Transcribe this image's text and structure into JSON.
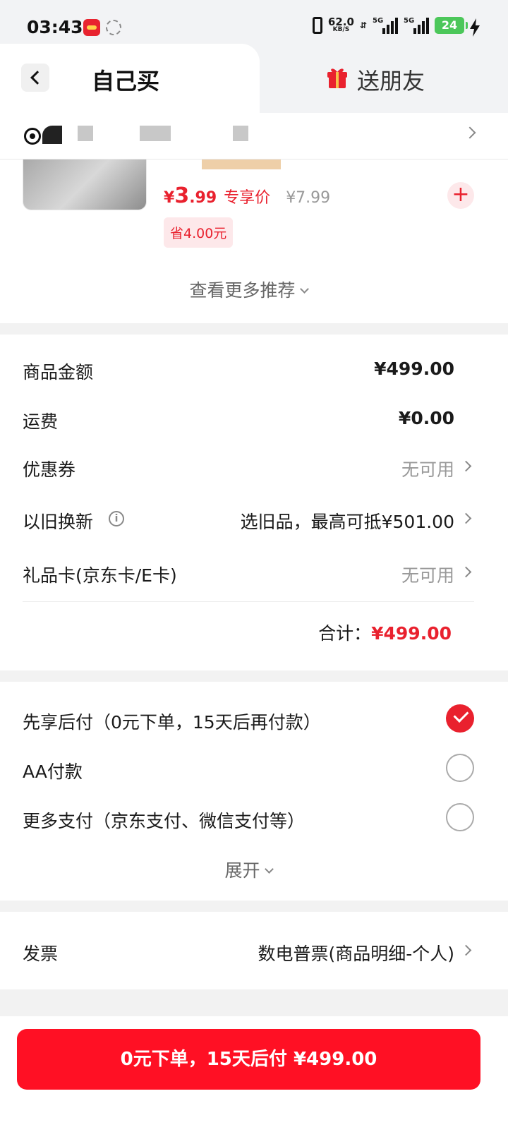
{
  "status_bar": {
    "time": "03:43",
    "net_speed": "62.0",
    "net_speed_unit": "KB/S",
    "signal_label_1": "5G",
    "signal_label_2": "5G",
    "battery": "24"
  },
  "tabs": {
    "self_buy": "自己买",
    "gift_friend": "送朋友"
  },
  "recommendation": {
    "price_symbol": "¥",
    "price_main": "3",
    "price_cents": ".99",
    "price_tag": "专享价",
    "original_price": "¥7.99",
    "savings": "省4.00元",
    "see_more": "查看更多推荐"
  },
  "amounts": {
    "goods_label": "商品金额",
    "goods_value": "¥499.00",
    "shipping_label": "运费",
    "shipping_value": "¥0.00",
    "coupon_label": "优惠券",
    "coupon_value": "无可用",
    "tradein_label": "以旧换新",
    "tradein_value": "选旧品，最高可抵¥501.00",
    "giftcard_label": "礼品卡(京东卡/E卡)",
    "giftcard_value": "无可用",
    "total_label": "合计：",
    "total_value": "¥499.00"
  },
  "payment": {
    "options": [
      {
        "label": "先享后付（0元下单，15天后再付款）",
        "selected": true
      },
      {
        "label": "AA付款",
        "selected": false
      },
      {
        "label": "更多支付（京东支付、微信支付等）",
        "selected": false
      }
    ],
    "expand": "展开"
  },
  "invoice": {
    "label": "发票",
    "value": "数电普票(商品明细-个人)"
  },
  "submit": {
    "label": "0元下单，15天后付 ¥499.00"
  },
  "colors": {
    "accent": "#e9212e",
    "submit_bg": "#ff1024"
  }
}
